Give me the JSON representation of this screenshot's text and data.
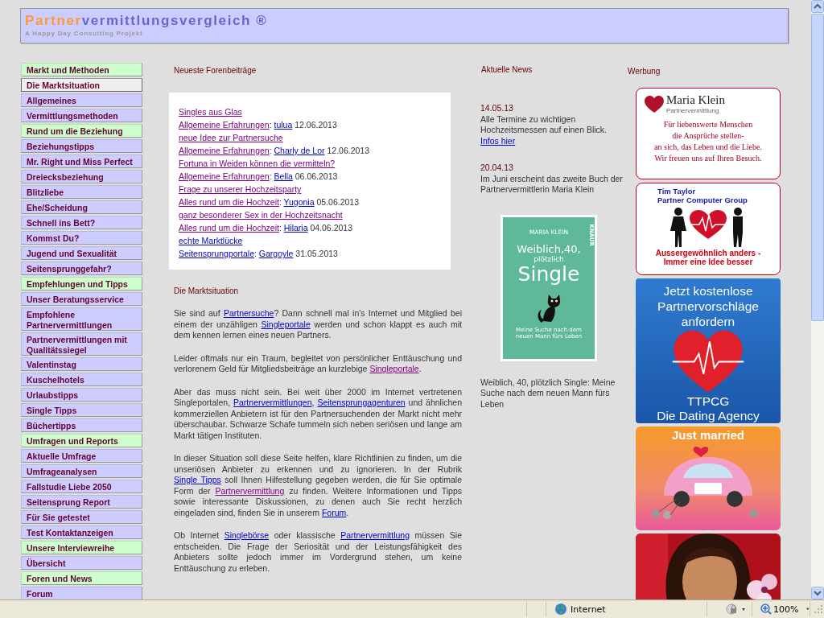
{
  "header": {
    "title": [
      {
        "text": "Partner",
        "color": "#ff9933"
      },
      {
        "text": "vermittlungsvergleich ®",
        "color": "#6666cc"
      }
    ],
    "subtitle": "A Happy Day Consulting Projekt"
  },
  "nav": [
    {
      "label": "Markt und Methoden",
      "kind": "section",
      "selected": false
    },
    {
      "label": "Die Marktsituation",
      "kind": "link",
      "selected": true
    },
    {
      "label": "Allgemeines",
      "kind": "link",
      "selected": false
    },
    {
      "label": "Vermittlungsmethoden",
      "kind": "link",
      "selected": false
    },
    {
      "label": "Rund um die Beziehung",
      "kind": "section",
      "selected": false
    },
    {
      "label": "Beziehungstipps",
      "kind": "link",
      "selected": false
    },
    {
      "label": "Mr. Right und Miss Perfect",
      "kind": "link",
      "selected": false
    },
    {
      "label": "Dreiecksbeziehung",
      "kind": "link",
      "selected": false
    },
    {
      "label": "Blitzliebe",
      "kind": "link",
      "selected": false
    },
    {
      "label": "Ehe/Scheidung",
      "kind": "link",
      "selected": false
    },
    {
      "label": "Schnell ins Bett?",
      "kind": "link",
      "selected": false
    },
    {
      "label": "Kommst Du?",
      "kind": "link",
      "selected": false
    },
    {
      "label": "Jugend und Sexualität",
      "kind": "link",
      "selected": false
    },
    {
      "label": "Seitensprunggefahr?",
      "kind": "link",
      "selected": false
    },
    {
      "label": "Empfehlungen und Tipps",
      "kind": "section",
      "selected": false
    },
    {
      "label": "Unser Beratungsservice",
      "kind": "link",
      "selected": false
    },
    {
      "label": "Empfohlene Partnervermittlungen",
      "kind": "link",
      "selected": false
    },
    {
      "label": "Partnervermittlungen mit Qualitätssiegel",
      "kind": "link",
      "selected": false
    },
    {
      "label": "Valentinstag",
      "kind": "link",
      "selected": false
    },
    {
      "label": "Kuschelhotels",
      "kind": "link",
      "selected": false
    },
    {
      "label": "Urlaubstipps",
      "kind": "link",
      "selected": false
    },
    {
      "label": "Single Tipps",
      "kind": "link",
      "selected": false
    },
    {
      "label": "Büchertipps",
      "kind": "link",
      "selected": false
    },
    {
      "label": "Umfragen und Reports",
      "kind": "section",
      "selected": false
    },
    {
      "label": "Aktuelle Umfrage",
      "kind": "link",
      "selected": false
    },
    {
      "label": "Umfrageanalysen",
      "kind": "link",
      "selected": false
    },
    {
      "label": "Fallstudie Liebe 2050",
      "kind": "link",
      "selected": false
    },
    {
      "label": "Seitensprung Report",
      "kind": "link",
      "selected": false
    },
    {
      "label": "Für Sie getestet",
      "kind": "link",
      "selected": false
    },
    {
      "label": "Test Kontaktanzeigen",
      "kind": "link",
      "selected": false
    },
    {
      "label": "Unsere Interviewreihe",
      "kind": "section",
      "selected": false
    },
    {
      "label": "Übersicht",
      "kind": "link",
      "selected": false
    },
    {
      "label": "Foren und News",
      "kind": "section",
      "selected": false
    },
    {
      "label": "Forum",
      "kind": "link",
      "selected": false
    }
  ],
  "forum": {
    "heading": "Neueste Forenbeiträge",
    "posts": [
      {
        "topic": {
          "text": "Singles aus Glas",
          "visited": true
        },
        "board": {
          "text": "Allgemeine Erfahrungen",
          "visited": true
        },
        "sep": ":",
        "author": {
          "text": "tulua",
          "visited": false
        },
        "date": "12.06.2013"
      },
      {
        "topic": {
          "text": "neue Idee zur Partnersuche",
          "visited": true
        },
        "board": {
          "text": "Allgemeine Erfahrungen",
          "visited": true
        },
        "sep": ":",
        "author": {
          "text": "Charly de Lor",
          "visited": false
        },
        "date": "12.06.2013"
      },
      {
        "topic": {
          "text": "Fortuna in Weiden können die vermitteln?",
          "visited": true
        },
        "board": {
          "text": "Allgemeine Erfahrungen",
          "visited": true
        },
        "sep": ":",
        "author": {
          "text": "Bella",
          "visited": false
        },
        "date": "06.06.2013"
      },
      {
        "topic": {
          "text": "Frage zu unserer Hochzeitsparty",
          "visited": true
        },
        "board": {
          "text": "Alles rund um die Hochzeit",
          "visited": true
        },
        "sep": ":",
        "author": {
          "text": "Yugonia",
          "visited": false
        },
        "date": "05.06.2013"
      },
      {
        "topic": {
          "text": "ganz besonderer Sex in der Hochzeitsnacht",
          "visited": true
        },
        "board": {
          "text": "Alles rund um die Hochzeit",
          "visited": true
        },
        "sep": ":",
        "author": {
          "text": "Hilaria",
          "visited": false
        },
        "date": "04.06.2013"
      },
      {
        "topic": {
          "text": "echte Marktlücke",
          "visited": false
        },
        "board": {
          "text": "Seitensprungportale",
          "visited": false
        },
        "sep": ":",
        "author": {
          "text": "Gargoyle",
          "visited": false
        },
        "date": "31.05.2013"
      }
    ]
  },
  "article": {
    "heading": "Die Marktsituation",
    "paragraphs": [
      [
        {
          "text": "Sie sind auf "
        },
        {
          "link": "Partnersuche",
          "visited": false
        },
        {
          "text": "? Dann schnell mal in's Internet und Mitglied bei einem der unzähligen "
        },
        {
          "link": "Singleportale",
          "visited": false
        },
        {
          "text": " werden und schon klappt es auch mit dem kennen lernen eines neuen Partners."
        }
      ],
      [
        {
          "text": "Leider oftmals nur ein Traum, begleitet von persönlicher Enttäuschung und verlorenem Geld für Mitgliedsbeiträge an kurzlebige "
        },
        {
          "link": "Singleportale",
          "visited": true
        },
        {
          "text": "."
        }
      ],
      [
        {
          "text": "Aber das muss nicht sein. Bei weit über 2000 im Internet vertretenen Singleportalen, "
        },
        {
          "link": "Partnervermittlungen",
          "visited": false
        },
        {
          "text": ", "
        },
        {
          "link": "Seitensprungagenturen",
          "visited": false
        },
        {
          "text": " und ähnlichen kommerziellen Anbietern ist für den Partnersuchenden der Markt nicht mehr überschaubar. Schwarze Schafe tummeln sich neben seriösen und lange am Markt tätigen Instituten."
        }
      ],
      [
        {
          "text": "In dieser Situation soll diese Seite helfen, klare Richtlinien zu finden, um die unseriösen Anbieter zu erkennen und zu ignorieren. In der Rubrik "
        },
        {
          "link": "Single Tipps",
          "visited": false
        },
        {
          "text": " soll Ihnen Hilfestellung gegeben werden, die für Sie optimale Form der "
        },
        {
          "link": "Partnervermittlung",
          "visited": true
        },
        {
          "text": " zu finden. Weitere Informationen und Tipps sowie interessante Diskussionen, zu denen auch Sie recht herzlich eingeladen sind, finden Sie in unserem "
        },
        {
          "link": "Forum",
          "visited": false
        },
        {
          "text": "."
        }
      ],
      [
        {
          "text": "Ob Internet "
        },
        {
          "link": "Singlebörse",
          "visited": false
        },
        {
          "text": " oder klassische "
        },
        {
          "link": "Partnervermittlung",
          "visited": false
        },
        {
          "text": " müssen Sie entscheiden. Die Frage der Seriosität und der Leistungsfähigkeit des Anbieters sollte jedoch immer im Vordergrund stehen, um keine Enttäuschung zu erleben."
        }
      ]
    ]
  },
  "news": {
    "heading": "Aktuelle News",
    "items": [
      {
        "date": "14.05.13",
        "text": "Alle Termine zu wichtigen Hochzeitsmessen auf einen Blick.",
        "link": {
          "text": "Infos hier",
          "visited": false
        }
      },
      {
        "date": "20.04.13",
        "text": "Im Juni erscheint das zweite Buch der Partnervermittlerin Maria Klein"
      }
    ],
    "book": {
      "author": "MARIA KLEIN",
      "publisher": "KNAUR",
      "title_lines": [
        "Weiblich,40,",
        "plötzlich",
        "Single"
      ],
      "subtitle": "Meine Suche nach dem neuen Mann fürs Leben"
    },
    "caption": "Weiblich, 40, plötzlich Single: Meine Suche nach dem neuen Mann fürs Leben"
  },
  "ads": {
    "heading": "Werbung",
    "banners": [
      {
        "kind": "logo",
        "name": "Maria Klein",
        "tagline": "Partnervermittlung",
        "lines": [
          "Für liebenswerte Menschen",
          "die Ansprüche stellen-",
          "an sich, das Leben und die Liebe.",
          "Wir freuen uns auf Ihren Besuch."
        ]
      },
      {
        "kind": "couple",
        "lines": [
          "Tim Taylor",
          "Partner Computer Group"
        ],
        "slogan": [
          "Aussergewöhnlich anders -",
          "Immer eine Idee besser"
        ]
      },
      {
        "kind": "heart",
        "lines": [
          "Jetzt kostenlose",
          "Partnervorschläge",
          "anfordern"
        ],
        "footer": [
          "TTPCG",
          "Die Dating Agency"
        ]
      },
      {
        "kind": "wedding",
        "title": "Just married"
      },
      {
        "kind": "picture"
      }
    ]
  },
  "status_bar": {
    "zone": "Internet",
    "zoom": "100%"
  }
}
